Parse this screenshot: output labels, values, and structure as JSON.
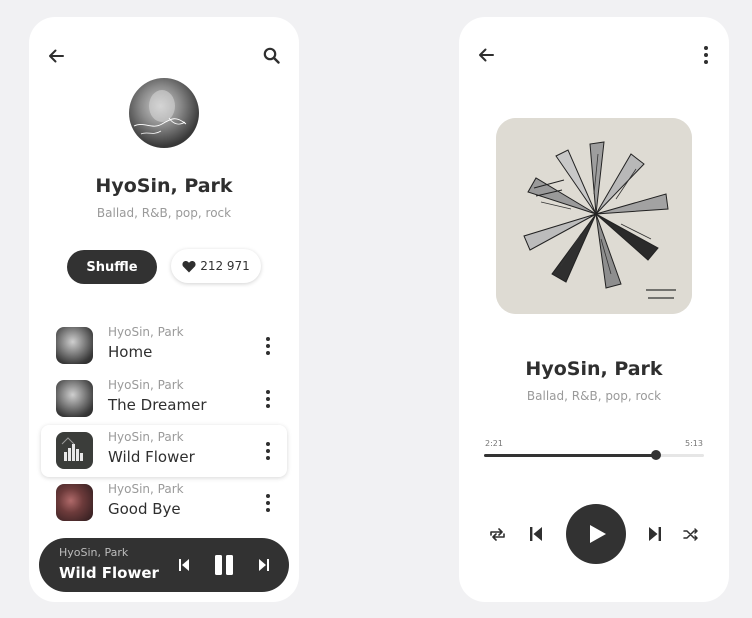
{
  "artist_page": {
    "artist_name": "HyoSin, Park",
    "genres": "Ballad, R&B, pop, rock",
    "shuffle_label": "Shuffle",
    "likes_count": "212 971",
    "tracks": [
      {
        "artist": "HyoSin, Park",
        "title": "Home"
      },
      {
        "artist": "HyoSin, Park",
        "title": "The Dreamer"
      },
      {
        "artist": "HyoSin, Park",
        "title": "Wild Flower"
      },
      {
        "artist": "HyoSin, Park",
        "title": "Good Bye"
      }
    ],
    "mini_player": {
      "artist": "HyoSin, Park",
      "title": "Wild Flower"
    }
  },
  "now_playing": {
    "artist_name": "HyoSin, Park",
    "genres": "Ballad, R&B, pop, rock",
    "elapsed": "2:21",
    "duration": "5:13",
    "progress_fraction": 0.78
  },
  "icons": {
    "back": "arrow-left-icon",
    "search": "search-icon",
    "more": "more-vertical-icon",
    "heart": "heart-icon",
    "prev": "skip-previous-icon",
    "next": "skip-next-icon",
    "pause": "pause-icon",
    "play": "play-icon",
    "repeat": "repeat-icon",
    "shuffle": "shuffle-icon"
  },
  "colors": {
    "dark": "#323232",
    "muted": "#9a9a9a",
    "background": "#f1f1f3"
  }
}
